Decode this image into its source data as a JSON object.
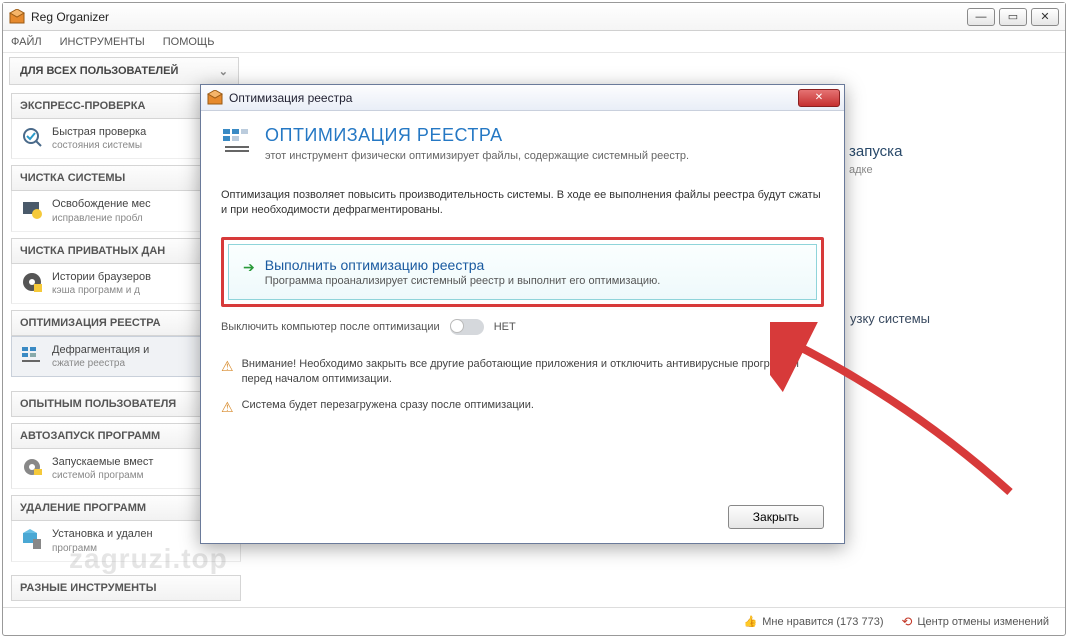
{
  "app": {
    "title": "Reg Organizer"
  },
  "menu": {
    "file": "ФАЙЛ",
    "tools": "ИНСТРУМЕНТЫ",
    "help": "ПОМОЩЬ"
  },
  "section": {
    "all_users": "ДЛЯ ВСЕХ ПОЛЬЗОВАТЕЛЕЙ"
  },
  "sidebar": {
    "g1": {
      "head": "ЭКСПРЕСС-ПРОВЕРКА",
      "i1": "Быстрая проверка",
      "i1s": "состояния системы"
    },
    "g2": {
      "head": "ЧИСТКА СИСТЕМЫ",
      "i1": "Освобождение мес",
      "i1s": "исправление пробл"
    },
    "g3": {
      "head": "ЧИСТКА ПРИВАТНЫХ ДАН",
      "i1": "Истории браузеров",
      "i1s": "кэша программ и д"
    },
    "g4": {
      "head": "ОПТИМИЗАЦИЯ РЕЕСТРА",
      "i1": "Дефрагментация и",
      "i1s": "сжатие реестра"
    },
    "adv": "ОПЫТНЫМ ПОЛЬЗОВАТЕЛЯ",
    "g5": {
      "head": "АВТОЗАПУСК ПРОГРАММ",
      "i1": "Запускаемые вмест",
      "i1s": "системой программ"
    },
    "g6": {
      "head": "УДАЛЕНИЕ ПРОГРАММ",
      "i1": "Установка и удален",
      "i1s": "программ"
    },
    "g7": {
      "head": "РАЗНЫЕ ИНСТРУМЕНТЫ"
    }
  },
  "right": {
    "ghost1a": "запуска",
    "ghost1b": "адке",
    "ghost2": "узку системы"
  },
  "dialog": {
    "title": "Оптимизация реестра",
    "head_title": "ОПТИМИЗАЦИЯ РЕЕСТРА",
    "head_sub": "этот инструмент физически оптимизирует файлы, содержащие системный реестр.",
    "desc": "Оптимизация позволяет повысить производительность системы. В ходе ее выполнения файлы реестра будут сжаты и при необходимости дефрагментированы.",
    "action_title": "Выполнить оптимизацию реестра",
    "action_sub": "Программа проанализирует системный реестр и выполнит его оптимизацию.",
    "toggle_label": "Выключить компьютер после оптимизации",
    "toggle_state": "НЕТ",
    "warn1": "Внимание! Необходимо закрыть все другие работающие приложения и отключить антивирусные программы перед началом оптимизации.",
    "warn2": "Система будет перезагружена сразу после оптимизации.",
    "close": "Закрыть"
  },
  "status": {
    "like": "Мне нравится (173 773)",
    "undo": "Центр отмены изменений"
  },
  "watermark": "zagruzi.top"
}
